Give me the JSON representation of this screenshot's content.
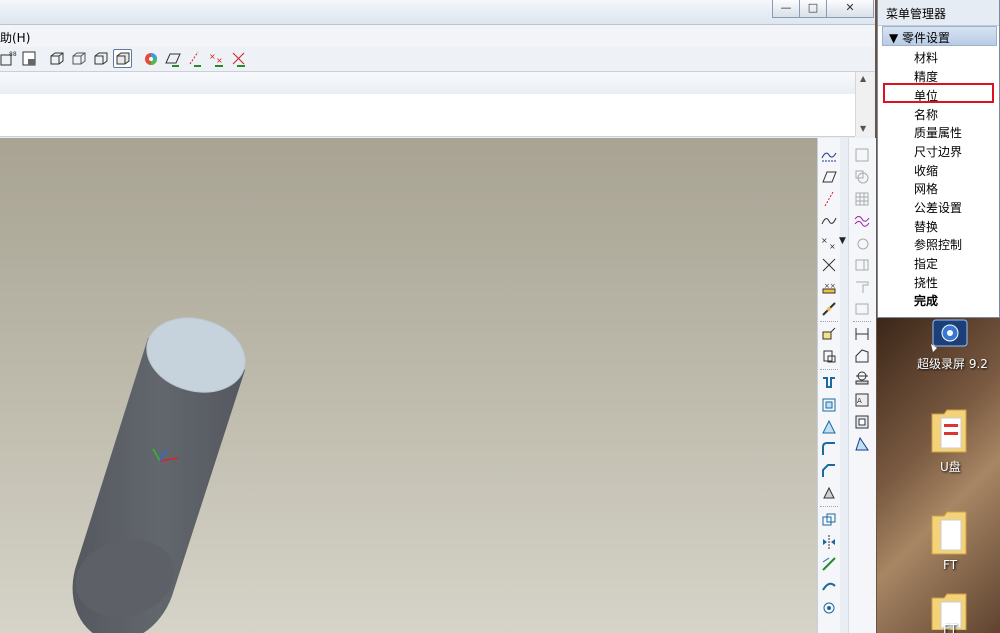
{
  "window": {
    "minimize_glyph": "—",
    "maximize_glyph": "□",
    "close_glyph": "✕"
  },
  "menubar": {
    "help_label": "助(H)"
  },
  "menu_manager": {
    "title": "菜单管理器",
    "section": "▼ 零件设置",
    "items": [
      "材料",
      "精度",
      "单位",
      "名称",
      "质量属性",
      "尺寸边界",
      "收缩",
      "网格",
      "公差设置",
      "替换",
      "参照控制",
      "指定",
      "挠性",
      "完成"
    ],
    "highlighted_item": "单位",
    "highlight_color": "#d9141f"
  },
  "desktop": {
    "icons": [
      {
        "label": "超级录屏 9.2",
        "icon": "screen-recorder-icon"
      },
      {
        "label": "U盘",
        "icon": "folder-icon"
      },
      {
        "label": "FT",
        "icon": "folder-icon"
      },
      {
        "label": "FT",
        "icon": "folder-icon"
      }
    ]
  },
  "viewport": {
    "model": "cylinder",
    "model_color": "#5f646a",
    "model_top_color": "#c8d4dd",
    "background_top": "#a8a393",
    "background_bottom": "#d6d4c8"
  }
}
